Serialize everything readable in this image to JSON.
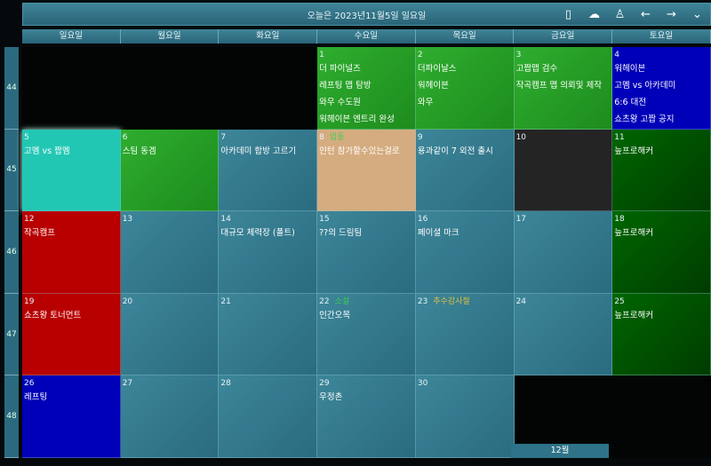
{
  "header": {
    "title": "오늘은 2023년11월5일 일요일",
    "icons": [
      "phone-icon",
      "cloud-check-icon",
      "person-icon",
      "arrow-left-icon",
      "arrow-right-icon",
      "chevron-down-icon"
    ]
  },
  "weekdays": [
    "일요일",
    "월요일",
    "화요일",
    "수요일",
    "목요일",
    "금요일",
    "토요일"
  ],
  "week_numbers": [
    "44",
    "45",
    "46",
    "47",
    "48"
  ],
  "colors": {
    "holiday_green": "#3ccf4e",
    "holiday_yellow": "#e0c040"
  },
  "cells": [
    {
      "style": "empty"
    },
    {
      "style": "empty"
    },
    {
      "style": "empty"
    },
    {
      "day": "1",
      "style": "green",
      "events": [
        "더 파이널즈",
        "레프팅 맵 탐방",
        "와우 수도원",
        "워헤이븐 엔트리 완성"
      ]
    },
    {
      "day": "2",
      "style": "green",
      "events": [
        "더파이날스",
        "워헤이븐",
        "와우"
      ]
    },
    {
      "day": "3",
      "style": "green",
      "events": [
        "고짭맵 검수",
        "작곡캠프 맵 의뢰및 제작"
      ]
    },
    {
      "day": "4",
      "style": "blue",
      "events": [
        "워헤이븐",
        "고멤 vs 아카데미",
        "6:6 대전",
        "쇼츠왕 고짭 공지"
      ]
    },
    {
      "day": "5",
      "style": "teal",
      "events": [
        "고멤 vs 짭멤"
      ]
    },
    {
      "day": "6",
      "style": "green",
      "events": [
        "스팀 동겜"
      ]
    },
    {
      "day": "7",
      "style": "",
      "events": [
        "아카데미 합방 고르기"
      ]
    },
    {
      "day": "8",
      "holiday": "입동",
      "holiday_color": "green",
      "style": "peach",
      "events": [
        "인턴 참가할수있는걸로"
      ]
    },
    {
      "day": "9",
      "style": "",
      "events": [
        "용과같이 7 외전 출시"
      ]
    },
    {
      "day": "10",
      "style": "dark",
      "events": []
    },
    {
      "day": "11",
      "style": "dgreen",
      "events": [
        "늪프로해커"
      ]
    },
    {
      "day": "12",
      "style": "red",
      "events": [
        "작곡캠프"
      ]
    },
    {
      "day": "13",
      "style": "",
      "events": []
    },
    {
      "day": "14",
      "style": "",
      "events": [
        "대규모 체력장 (폴트)"
      ]
    },
    {
      "day": "15",
      "style": "",
      "events": [
        "??의 드림팀"
      ]
    },
    {
      "day": "16",
      "style": "",
      "events": [
        "페이셜 마크"
      ]
    },
    {
      "day": "17",
      "style": "",
      "events": []
    },
    {
      "day": "18",
      "style": "dgreen",
      "events": [
        "늪프로해커"
      ]
    },
    {
      "day": "19",
      "style": "red",
      "events": [
        "쇼츠왕 토너먼트"
      ]
    },
    {
      "day": "20",
      "style": "",
      "events": []
    },
    {
      "day": "21",
      "style": "",
      "events": []
    },
    {
      "day": "22",
      "holiday": "소설",
      "holiday_color": "green",
      "style": "",
      "events": [
        "인간오목"
      ]
    },
    {
      "day": "23",
      "holiday": "추수감사절",
      "holiday_color": "yellow",
      "style": "",
      "events": []
    },
    {
      "day": "24",
      "style": "",
      "events": []
    },
    {
      "day": "25",
      "style": "dgreen",
      "events": [
        "늪프로해커"
      ]
    },
    {
      "day": "26",
      "style": "blue",
      "events": [
        "레프팅"
      ]
    },
    {
      "day": "27",
      "style": "",
      "events": []
    },
    {
      "day": "28",
      "style": "",
      "events": []
    },
    {
      "day": "29",
      "style": "",
      "events": [
        "우정촌"
      ]
    },
    {
      "day": "30",
      "style": "",
      "events": []
    },
    {
      "style": "empty"
    },
    {
      "style": "empty"
    }
  ],
  "next_month_label": "12월"
}
